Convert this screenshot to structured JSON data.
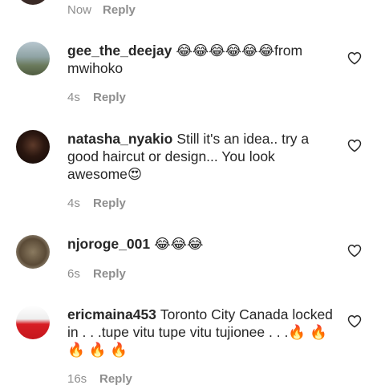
{
  "top": {
    "time": "Now",
    "reply": "Reply"
  },
  "comments": [
    {
      "username": "gee_the_deejay",
      "text": "😂😂😂😂😂😂from mwihoko",
      "time": "4s",
      "reply": "Reply"
    },
    {
      "username": "natasha_nyakio",
      "text": "Still it's an idea.. try a good haircut or design... You look awesome😍",
      "time": "4s",
      "reply": "Reply"
    },
    {
      "username": "njoroge_001",
      "text": "😂😂😂",
      "time": "6s",
      "reply": "Reply"
    },
    {
      "username": "ericmaina453",
      "text": "Toronto City Canada locked in . . .tupe vitu tupe vitu tujionee . . .🔥 🔥 🔥 🔥 🔥",
      "time": "16s",
      "reply": "Reply"
    }
  ],
  "icons": {
    "like": "heart-outline-icon"
  },
  "colors": {
    "text": "#262626",
    "secondary": "#8e8e8e",
    "background": "#ffffff"
  }
}
